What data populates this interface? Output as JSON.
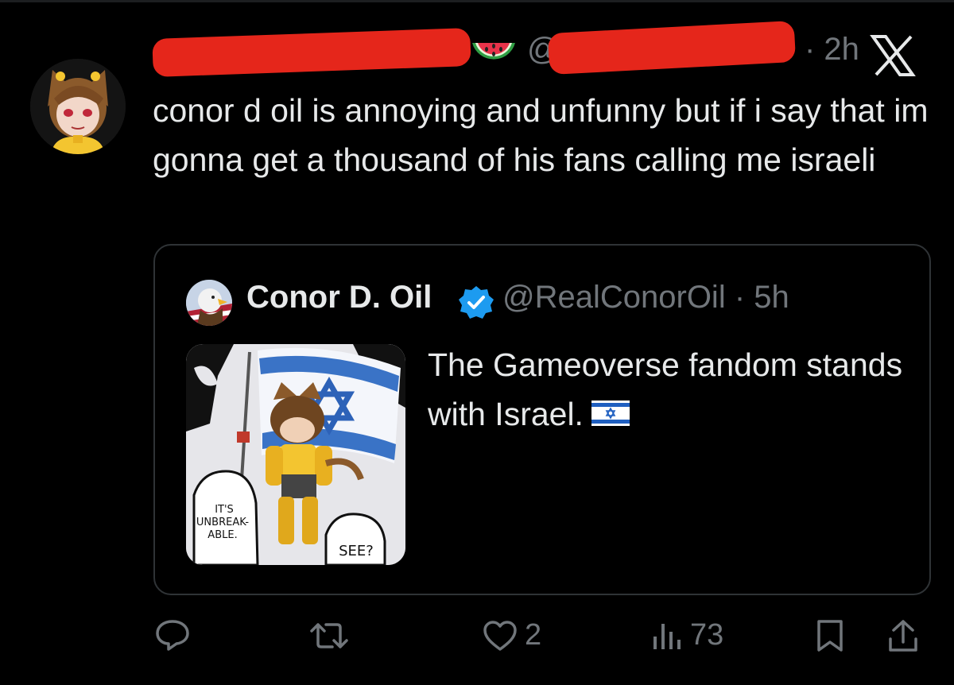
{
  "tweet": {
    "handle_prefix": "@",
    "time": "· 2h",
    "text": "conor d oil is annoying and unfunny but if i say that im gonna get a thousand of his fans calling me israeli"
  },
  "quote": {
    "name": "Conor D. Oil",
    "handle_time": "@RealConorOil · 5h",
    "text": "The Gameoverse fandom stands with Israel.",
    "image_speech_left": "IT'S UNBREAK- ABLE.",
    "image_speech_right": "SEE?"
  },
  "actions": {
    "likes": "2",
    "views": "73"
  },
  "colors": {
    "background": "#000000",
    "text": "#e7e9ea",
    "muted": "#71767b",
    "border": "#2f3336",
    "redaction": "#e5261b",
    "verified": "#1d9bf0"
  },
  "icons": {
    "reply": "reply-icon",
    "retweet": "retweet-icon",
    "like": "heart-icon",
    "views": "views-icon",
    "bookmark": "bookmark-icon",
    "share": "share-icon"
  }
}
